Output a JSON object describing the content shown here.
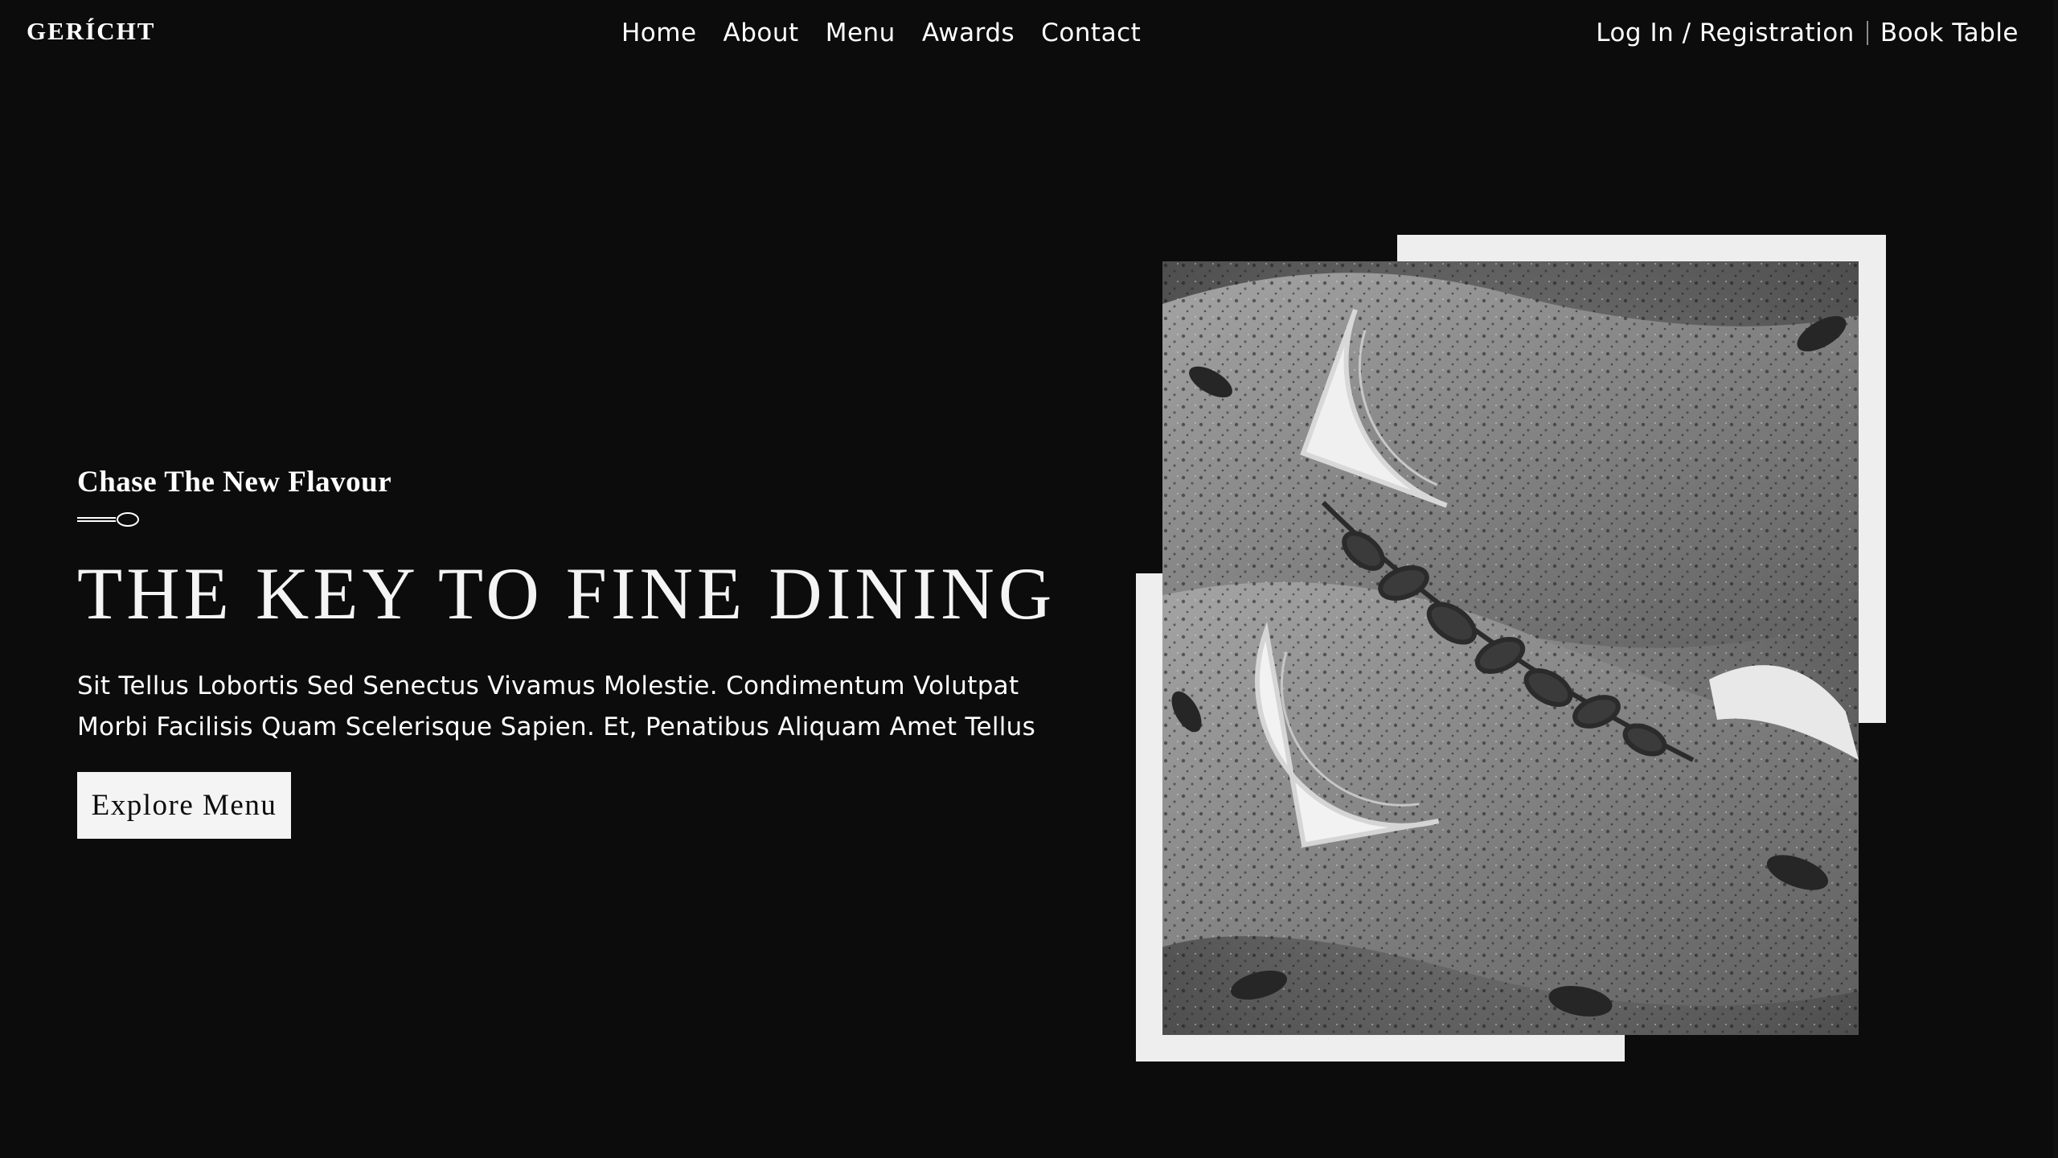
{
  "brand": {
    "logo": "GERÍCHT"
  },
  "nav": {
    "links": [
      "Home",
      "About",
      "Menu",
      "Awards",
      "Contact"
    ],
    "login_label": "Log In / Registration",
    "book_label": "Book Table"
  },
  "hero": {
    "subtitle": "Chase The New Flavour",
    "headline": "THE KEY TO FINE DINING",
    "description": "Sit Tellus Lobortis Sed Senectus Vivamus Molestie. Condimentum Volutpat Morbi Facilisis Quam Scelerisque Sapien. Et, Penatibus Aliquam Amet Tellus",
    "cta_label": "Explore Menu"
  },
  "icons": {
    "spoon": "spoon-icon"
  },
  "colors": {
    "background": "#0c0c0c",
    "text": "#ffffff",
    "frame": "#eeeeee",
    "button_bg": "#f4f4f4",
    "button_text": "#0c0c0c"
  }
}
